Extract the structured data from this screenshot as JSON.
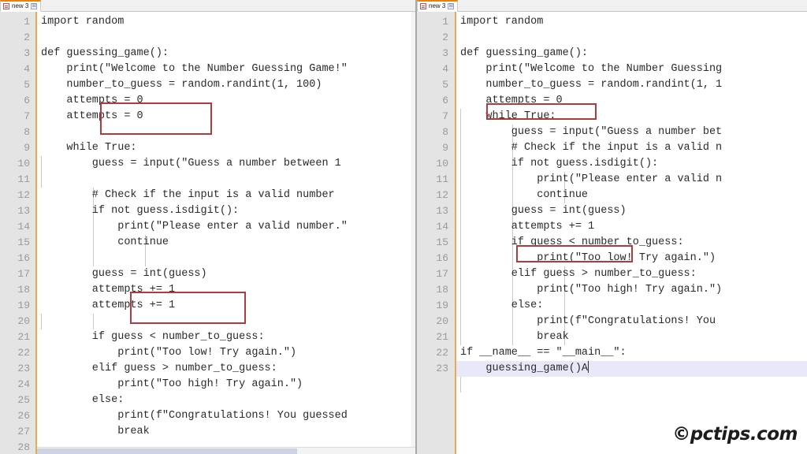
{
  "window": {
    "app": "Notepad++ side-by-side code comparison",
    "watermark": "©pctips.com"
  },
  "colors": {
    "accent_orange": "#e8820c",
    "gutter_border": "#e8a854",
    "annotation_red": "#b23a3a",
    "current_line_highlight": "#e8e8f8",
    "gutter_bg": "#e4e4e4",
    "line_number_fg": "#9a9a9a",
    "code_fg": "#2a2a2a"
  },
  "left_panel": {
    "tab": {
      "label": "new 3",
      "close_glyph": "☒",
      "icon": "document-icon"
    },
    "line_numbers": [
      "1",
      "2",
      "3",
      "4",
      "5",
      "6",
      "7",
      "8",
      "9",
      "10",
      "11",
      "12",
      "13",
      "14",
      "15",
      "16",
      "17",
      "18",
      "19",
      "20",
      "21",
      "22",
      "23",
      "24",
      "25",
      "26",
      "27",
      "28"
    ],
    "lines": [
      "import random",
      "",
      "def guessing_game():",
      "    print(\"Welcome to the Number Guessing Game!\"",
      "    number_to_guess = random.randint(1, 100)",
      "    attempts = 0",
      "    attempts = 0",
      "",
      "    while True:",
      "        guess = input(\"Guess a number between 1",
      "",
      "        # Check if the input is a valid number",
      "        if not guess.isdigit():",
      "            print(\"Please enter a valid number.\"",
      "            continue",
      "",
      "        guess = int(guess)",
      "        attempts += 1",
      "        attempts += 1",
      "",
      "        if guess < number_to_guess:",
      "            print(\"Too low! Try again.\")",
      "        elif guess > number_to_guess:",
      "            print(\"Too high! Try again.\")",
      "        else:",
      "            print(f\"Congratulations! You guessed",
      "            break",
      ""
    ],
    "annotations": [
      {
        "label": "duplicate-attempts-init-box",
        "lines": [
          6,
          7
        ],
        "text": "attempts = 0"
      },
      {
        "label": "duplicate-attempts-increment-box",
        "lines": [
          18,
          19
        ],
        "text": "attempts += 1"
      }
    ],
    "scrollbar": {
      "horizontal": true,
      "vertical": true
    }
  },
  "right_panel": {
    "tab": {
      "label": "new 3",
      "close_glyph": "☒",
      "icon": "document-icon"
    },
    "line_numbers": [
      "1",
      "2",
      "3",
      "4",
      "5",
      "6",
      "7",
      "8",
      "9",
      "10",
      "11",
      "12",
      "13",
      "14",
      "15",
      "16",
      "17",
      "18",
      "19",
      "20",
      "21",
      "22",
      "23"
    ],
    "lines": [
      "import random",
      "",
      "def guessing_game():",
      "    print(\"Welcome to the Number Guessing",
      "    number_to_guess = random.randint(1, 1",
      "    attempts = 0",
      "    while True:",
      "        guess = input(\"Guess a number bet",
      "        # Check if the input is a valid n",
      "        if not guess.isdigit():",
      "            print(\"Please enter a valid n",
      "            continue",
      "        guess = int(guess)",
      "        attempts += 1",
      "        if guess < number_to_guess:",
      "            print(\"Too low! Try again.\")",
      "        elif guess > number_to_guess:",
      "            print(\"Too high! Try again.\")",
      "        else:",
      "            print(f\"Congratulations! You",
      "            break",
      "if __name__ == \"__main__\":",
      "    guessing_game()A"
    ],
    "current_line": 23,
    "caret_visible": true,
    "annotations": [
      {
        "label": "attempts-init-box",
        "lines": [
          6
        ],
        "text": "attempts = 0"
      },
      {
        "label": "attempts-increment-box",
        "lines": [
          14
        ],
        "text": "attempts += 1"
      }
    ],
    "scrollbar": {
      "horizontal": false,
      "vertical": false
    }
  }
}
